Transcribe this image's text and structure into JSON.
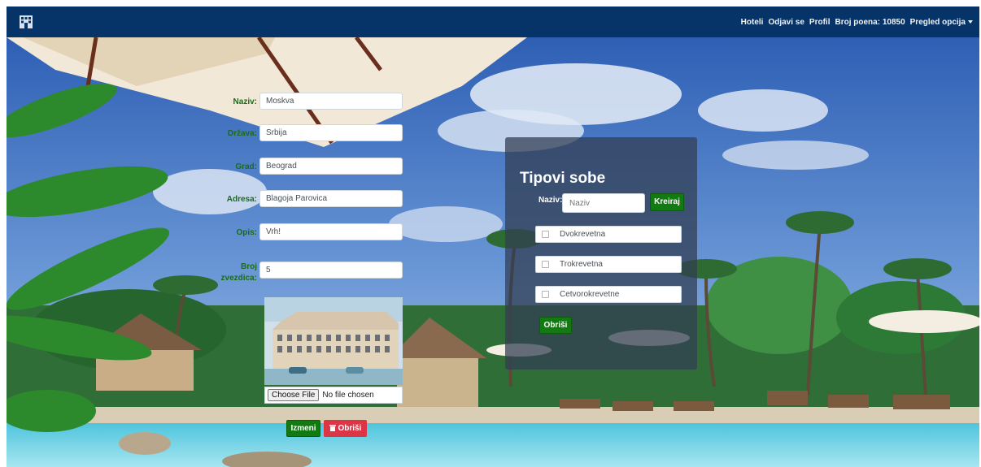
{
  "nav": {
    "links": [
      "Hoteli",
      "Odjavi se",
      "Profil",
      "Broj poena: 10850",
      "Pregled opcija"
    ]
  },
  "form": {
    "naziv": {
      "label": "Naziv:",
      "value": "Moskva"
    },
    "drzava": {
      "label": "Država:",
      "value": "Srbija"
    },
    "grad": {
      "label": "Grad:",
      "value": "Beograd"
    },
    "adresa": {
      "label": "Adresa:",
      "value": "Blagoja Parovica"
    },
    "opis": {
      "label": "Opis:",
      "value": "Vrh!"
    },
    "broj_zvezdica": {
      "label_line1": "Broj",
      "label_line2": "zvezdica:",
      "value": "5"
    },
    "file_button": "Choose File",
    "file_status": "No file chosen",
    "izmeni_button": "Izmeni",
    "obrisi_button": "Obriši"
  },
  "room_types": {
    "title": "Tipovi sobe",
    "naziv_label": "Naziv:",
    "naziv_placeholder": "Naziv",
    "create_button": "Kreiraj",
    "items": [
      "Dvokrevetna",
      "Trokrevetna",
      "Cetvorokrevetne"
    ],
    "delete_button": "Obriši"
  },
  "colors": {
    "navbar": "#063469",
    "label_green": "#1a6b1a",
    "button_green": "#117a11",
    "button_red": "#dc3545",
    "panel": "rgba(50,62,82,0.74)"
  }
}
